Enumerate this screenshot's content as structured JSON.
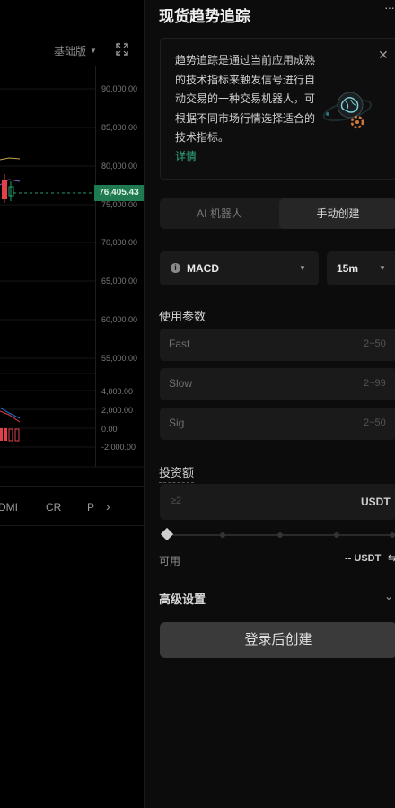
{
  "chart": {
    "version_label": "基础版",
    "current_price": "76,405.43",
    "y_labels": [
      "90,000.00",
      "85,000.00",
      "80,000.00",
      "75,000.00",
      "70,000.00",
      "65,000.00",
      "60,000.00",
      "55,000.00",
      "4,000.00",
      "2,000.00",
      "0.00",
      "-2,000.00"
    ],
    "indicator_tabs": [
      "DMI",
      "CR",
      "P"
    ],
    "colors": {
      "price_tag": "#1f7a52",
      "up": "#23a06a",
      "down": "#e0414b"
    }
  },
  "panel": {
    "title": "现货趋势追踪",
    "info_text": "趋势追踪是通过当前应用成熟的技术指标来触发信号进行自动交易的一种交易机器人，可根据不同市场行情选择适合的技术指标。",
    "info_link": "详情",
    "mode_tabs": {
      "ai": "AI 机器人",
      "manual": "手动创建"
    },
    "indicator_select": "MACD",
    "timeframe_select": "15m",
    "params_title": "使用参数",
    "params": [
      {
        "name": "Fast",
        "range": "2~50"
      },
      {
        "name": "Slow",
        "range": "2~99"
      },
      {
        "name": "Sig",
        "range": "2~50"
      }
    ],
    "invest_label": "投资额",
    "invest_placeholder": "≥2",
    "invest_unit": "USDT",
    "available_label": "可用",
    "available_value": "-- USDT",
    "advanced_label": "高级设置",
    "login_button": "登录后创建",
    "accent_color": "#2fa37a"
  }
}
